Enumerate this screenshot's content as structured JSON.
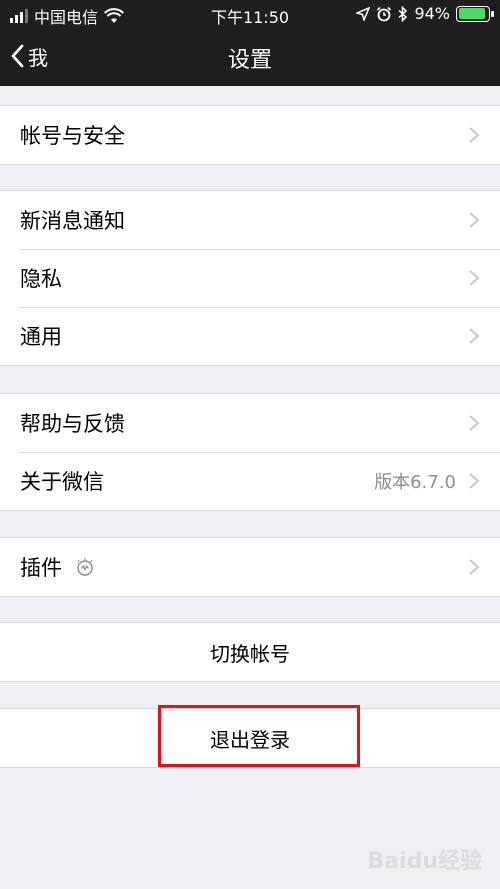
{
  "status_bar": {
    "carrier": "中国电信",
    "time": "下午11:50",
    "battery_percent": "94%",
    "battery_level": 0.94,
    "battery_color": "#4cd964"
  },
  "nav": {
    "back_label": "我",
    "title": "设置"
  },
  "groups": [
    {
      "items": [
        {
          "label": "帐号与安全"
        }
      ]
    },
    {
      "items": [
        {
          "label": "新消息通知"
        },
        {
          "label": "隐私"
        },
        {
          "label": "通用"
        }
      ]
    },
    {
      "items": [
        {
          "label": "帮助与反馈"
        },
        {
          "label": "关于微信",
          "detail": "版本6.7.0"
        }
      ]
    },
    {
      "items": [
        {
          "label": "插件",
          "icon": "lightbulb-icon"
        }
      ]
    }
  ],
  "actions": {
    "switch_account": "切换帐号",
    "logout": "退出登录"
  },
  "highlight_color": "#e0121a",
  "watermark": "Baidu经验"
}
